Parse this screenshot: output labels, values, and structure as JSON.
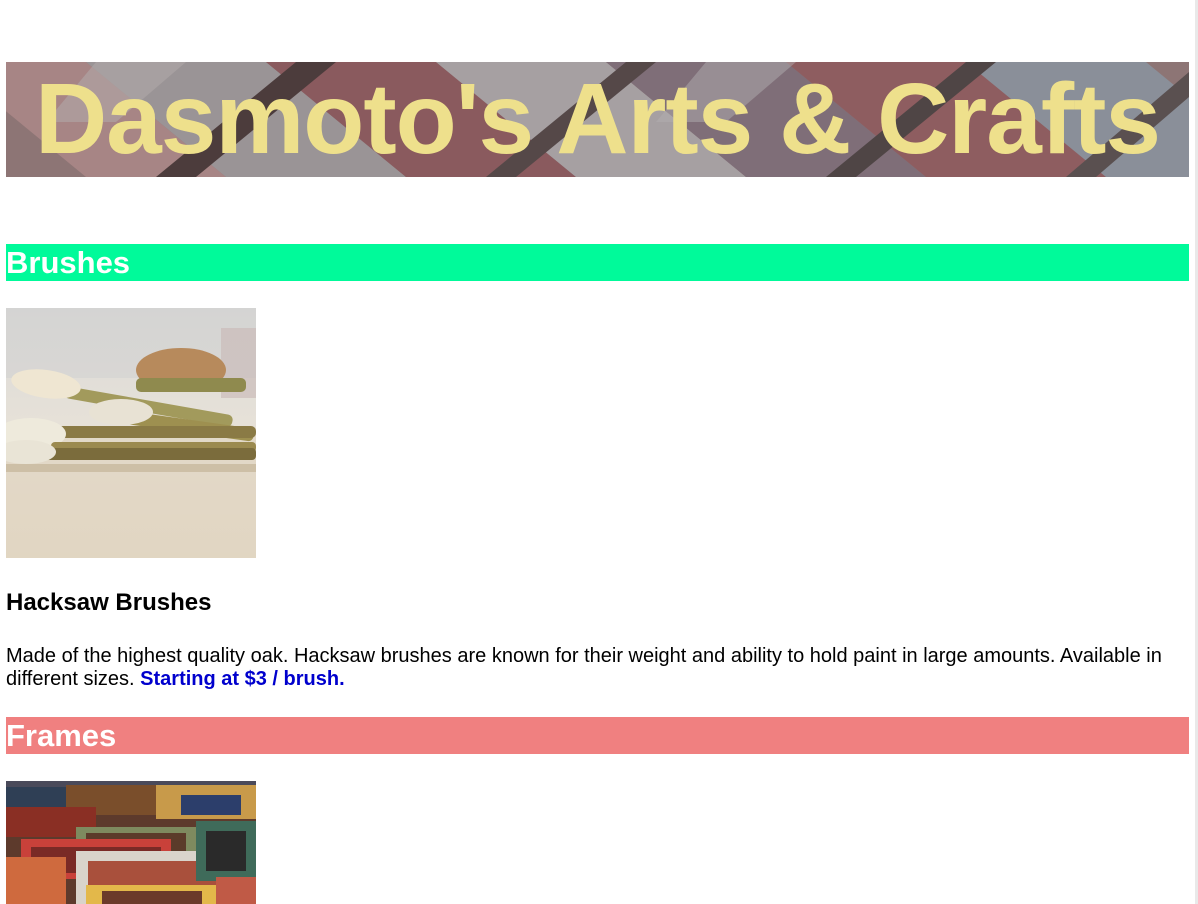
{
  "header": {
    "title": "Dasmoto's Arts & Crafts"
  },
  "sections": [
    {
      "heading": "Brushes",
      "heading_color": "#00fa9a",
      "image_subject": "paint-brushes-photo",
      "product_title": "Hacksaw Brushes",
      "description": "Made of the highest quality oak. Hacksaw brushes are known for their weight and ability to hold paint in large amounts. Available in different sizes.",
      "price": "Starting at $3 / brush."
    },
    {
      "heading": "Frames",
      "heading_color": "#f08080",
      "image_subject": "picture-frames-photo"
    }
  ],
  "colors": {
    "title_text": "#eee08c",
    "price_text": "#0000cd",
    "heading_text": "#ffffff"
  }
}
